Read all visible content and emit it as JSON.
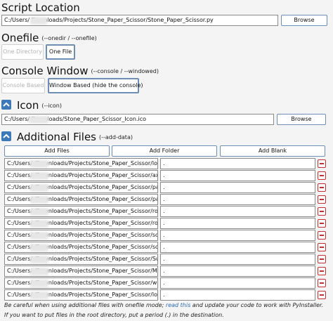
{
  "script": {
    "title": "Script Location",
    "path": "C:/Users/        Downloads/Projects/Stone_Paper_Scissor/Stone_Paper_Scissor.py",
    "browse_label": "Browse"
  },
  "onefile": {
    "title": "Onefile",
    "flags": "(--onedir / --onefile)",
    "options": [
      "One Directory",
      "One File"
    ]
  },
  "console": {
    "title": "Console Window",
    "flags": "(--console / --windowed)",
    "options": [
      "Console Based",
      "Window Based (hide the console)"
    ]
  },
  "icon": {
    "title": "Icon",
    "flags": "(--icon)",
    "path": "C:/Users/        Downloads/Stone_Paper_Scissor_Icon.ico",
    "browse_label": "Browse"
  },
  "additional": {
    "title": "Additional Files",
    "flags": "(--add-data)",
    "buttons": [
      "Add Files",
      "Add Folder",
      "Add Blank"
    ],
    "rows": [
      {
        "source": "C:/Users/          /Downloads/Projects/Stone_Paper_Scissor/los",
        "dest": "."
      },
      {
        "source": "C:/Users/          /Downloads/Projects/Stone_Paper_Scissor/axe",
        "dest": "."
      },
      {
        "source": "C:/Users/          /Downloads/Projects/Stone_Paper_Scissor/pap",
        "dest": "."
      },
      {
        "source": "C:/Users/          /Downloads/Projects/Stone_Paper_Scissor/pap",
        "dest": "."
      },
      {
        "source": "C:/Users/          /Downloads/Projects/Stone_Paper_Scissor/roc",
        "dest": "."
      },
      {
        "source": "C:/Users/          /Downloads/Projects/Stone_Paper_Scissor/roc",
        "dest": "."
      },
      {
        "source": "C:/Users/          /Downloads/Projects/Stone_Paper_Scissor/sci",
        "dest": "."
      },
      {
        "source": "C:/Users/          /Downloads/Projects/Stone_Paper_Scissor/sci",
        "dest": "."
      },
      {
        "source": "C:/Users/          /Downloads/Projects/Stone_Paper_Scissor/Su",
        "dest": "."
      },
      {
        "source": "C:/Users/          /Downloads/Projects/Stone_Paper_Scissor/Mu",
        "dest": "."
      },
      {
        "source": "C:/Users/          /Downloads/Projects/Stone_Paper_Scissor/wi",
        "dest": "."
      },
      {
        "source": "C:/Users/          /Downloads/Projects/Stone_Paper_Scissor/los",
        "dest": "."
      }
    ]
  },
  "notes": {
    "line1_pre": "Be careful when using additional files with onefile mode;",
    "line1_link": "read this",
    "line1_post": "and update your code to work with PyInstaller.",
    "line2": "If you want to put files in the root directory, put a period (.) in the destination."
  },
  "colors": {
    "accent": "#3d78b8",
    "remove": "#c62f2f",
    "link": "#2f6bb0"
  }
}
